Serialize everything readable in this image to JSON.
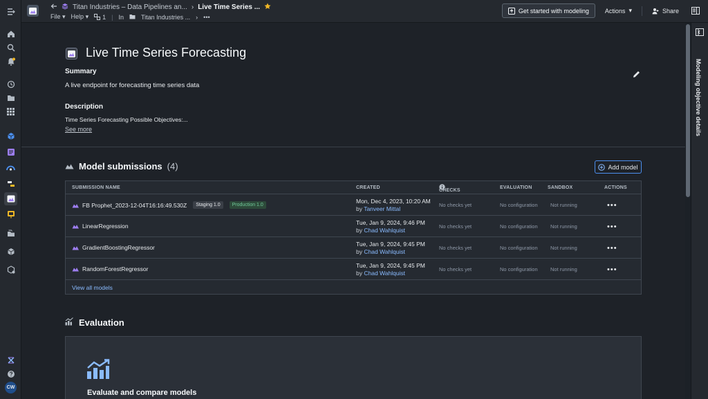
{
  "header": {
    "breadcrumb_parent": "Titan Industries – Data Pipelines an...",
    "breadcrumb_current": "Live Time Series ...",
    "menu_file": "File",
    "menu_help": "Help",
    "count_badge": "1",
    "in_label": "In",
    "in_location": "Titan Industries ...",
    "more": "•••",
    "get_started": "Get started with modeling",
    "actions": "Actions",
    "share": "Share"
  },
  "objective": {
    "title": "Live Time Series Forecasting",
    "summary_label": "Summary",
    "summary_text": "A live endpoint for forecasting time series data",
    "description_label": "Description",
    "description_text": "Time Series Forecasting Possible Objectives:...",
    "see_more": "See more"
  },
  "submissions": {
    "title": "Model submissions",
    "count": "(4)",
    "add_model": "Add model",
    "columns": {
      "name": "Submission name",
      "created": "Created",
      "checks": "Checks",
      "evaluation": "Evaluation",
      "sandbox": "Sandbox",
      "actions": "Actions"
    },
    "rows": [
      {
        "name": "FB Prophet_2023-12-04T16:16:49.530Z",
        "tag1": "Staging 1.0",
        "tag2": "Production 1.0",
        "created": "Mon, Dec 4, 2023, 10:20 AM",
        "by": "by",
        "user": "Tanveer Mittal",
        "checks": "No checks yet",
        "evaluation": "No configuration",
        "sandbox": "Not running",
        "actions": "•••"
      },
      {
        "name": "LinearRegression",
        "created": "Tue, Jan 9, 2024, 9:46 PM",
        "by": "by",
        "user": "Chad Wahlquist",
        "checks": "No checks yet",
        "evaluation": "No configuration",
        "sandbox": "Not running",
        "actions": "•••"
      },
      {
        "name": "GradientBoostingRegressor",
        "created": "Tue, Jan 9, 2024, 9:45 PM",
        "by": "by",
        "user": "Chad Wahlquist",
        "checks": "No checks yet",
        "evaluation": "No configuration",
        "sandbox": "Not running",
        "actions": "•••"
      },
      {
        "name": "RandomForestRegressor",
        "created": "Tue, Jan 9, 2024, 9:45 PM",
        "by": "by",
        "user": "Chad Wahlquist",
        "checks": "No checks yet",
        "evaluation": "No configuration",
        "sandbox": "Not running",
        "actions": "•••"
      }
    ],
    "view_all": "View all models"
  },
  "evaluation": {
    "title": "Evaluation",
    "card_title": "Evaluate and compare models"
  },
  "right_panel": {
    "label": "Modeling objective details"
  },
  "left_nav": {
    "user_initials": "CW"
  },
  "colors": {
    "accent": "#8abbff",
    "brand_purple": "#9d7ef0",
    "production_green": "#72ca9b"
  }
}
